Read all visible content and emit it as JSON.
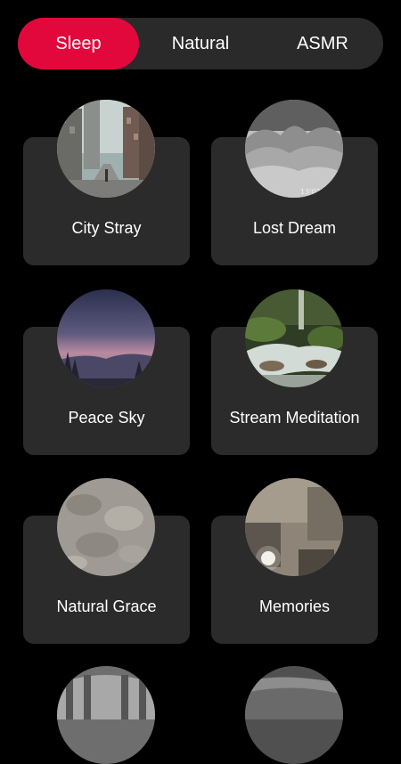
{
  "tabs": [
    {
      "label": "Sleep",
      "active": true
    },
    {
      "label": "Natural",
      "active": false
    },
    {
      "label": "ASMR",
      "active": false
    }
  ],
  "tracks": [
    {
      "title": "City Stray",
      "image": "city-street-image"
    },
    {
      "title": "Lost Dream",
      "image": "misty-mountains-image"
    },
    {
      "title": "Peace Sky",
      "image": "dusk-sky-image"
    },
    {
      "title": "Stream Meditation",
      "image": "forest-stream-image"
    },
    {
      "title": "Natural Grace",
      "image": "floral-texture-image"
    },
    {
      "title": "Memories",
      "image": "vintage-room-image"
    }
  ],
  "colors": {
    "accent": "#e2083b",
    "background": "#000000",
    "card": "#2b2b2b",
    "tabbar": "#2a2a2a"
  }
}
